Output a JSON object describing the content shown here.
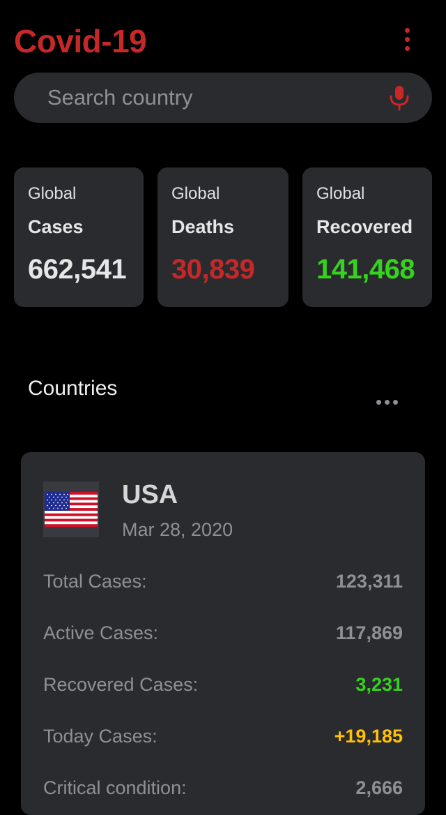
{
  "header": {
    "title": "Covid-19",
    "menu_icon": "more-vertical-icon",
    "accent_color": "#c62828"
  },
  "search": {
    "placeholder": "Search country",
    "value": "",
    "mic_icon": "microphone-icon"
  },
  "global_stats": [
    {
      "label_top": "Global",
      "label": "Cases",
      "value": "662,541",
      "color": "#e6e6e6"
    },
    {
      "label_top": "Global",
      "label": "Deaths",
      "value": "30,839",
      "color": "#c62828"
    },
    {
      "label_top": "Global",
      "label": "Recovered",
      "value": "141,468",
      "color": "#35d21e"
    }
  ],
  "countries": {
    "title": "Countries",
    "more_icon": "more-horizontal-icon",
    "items": [
      {
        "name": "USA",
        "date": "Mar 28, 2020",
        "flag_icon": "us-flag-icon",
        "rows": [
          {
            "label": "Total Cases:",
            "value": "123,311",
            "color": "#8e9095"
          },
          {
            "label": "Active Cases:",
            "value": "117,869",
            "color": "#8e9095"
          },
          {
            "label": "Recovered Cases:",
            "value": "3,231",
            "color": "#35d21e"
          },
          {
            "label": "Today Cases:",
            "value": "+19,185",
            "color": "#ffc107"
          },
          {
            "label": "Critical condition:",
            "value": "2,666",
            "color": "#8e9095"
          }
        ]
      }
    ]
  }
}
